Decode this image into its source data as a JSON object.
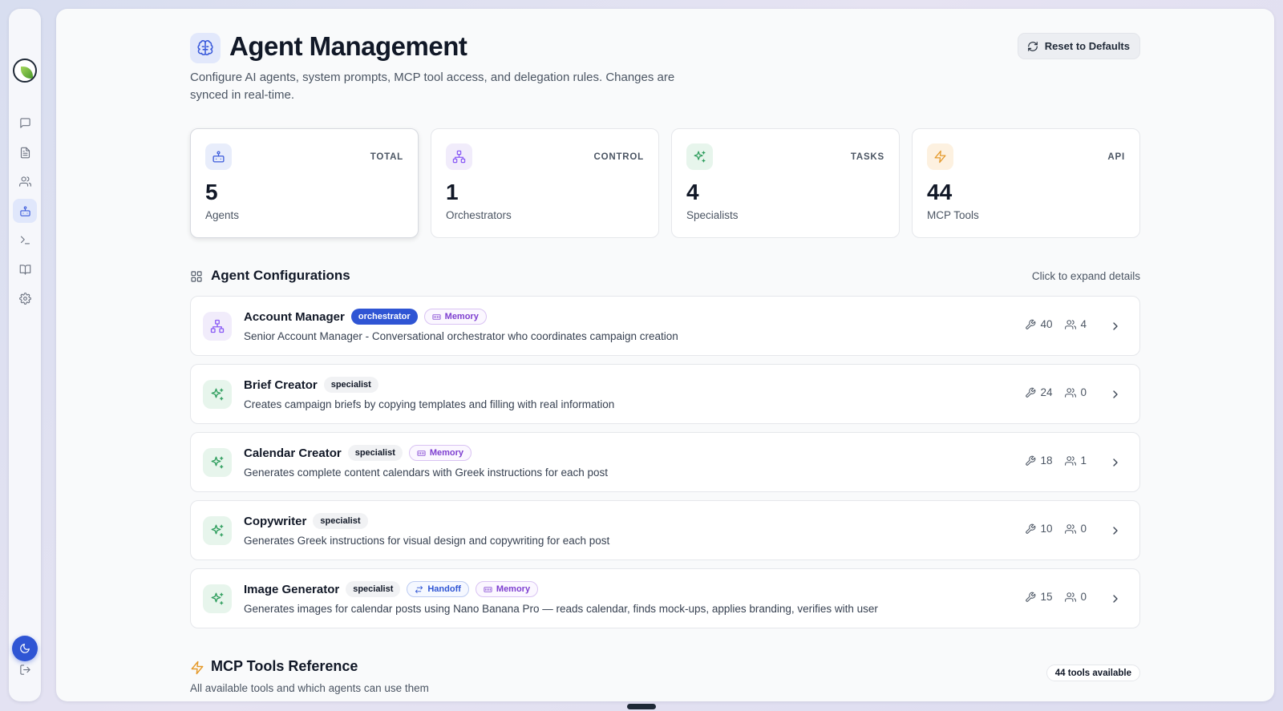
{
  "sidebar": {
    "items": [
      {
        "name": "chat",
        "icon": "message-square-icon"
      },
      {
        "name": "documents",
        "icon": "file-text-icon"
      },
      {
        "name": "users",
        "icon": "users-icon"
      },
      {
        "name": "agents",
        "icon": "bot-icon",
        "active": true
      },
      {
        "name": "terminal",
        "icon": "terminal-icon"
      },
      {
        "name": "docs",
        "icon": "book-open-icon"
      },
      {
        "name": "settings",
        "icon": "gear-icon"
      }
    ],
    "theme_icon": "moon-icon",
    "logout_icon": "log-out-icon"
  },
  "header": {
    "title": "Agent Management",
    "description": "Configure AI agents, system prompts, MCP tool access, and delegation rules. Changes are synced in real-time.",
    "reset_label": "Reset to Defaults"
  },
  "stats": [
    {
      "tag": "TOTAL",
      "value": "5",
      "label": "Agents",
      "icon": "bot-icon",
      "accent": "#3b5bdb",
      "bg": "#e8edfb"
    },
    {
      "tag": "CONTROL",
      "value": "1",
      "label": "Orchestrators",
      "icon": "network-icon",
      "accent": "#8b5cf6",
      "bg": "#f1ecfb"
    },
    {
      "tag": "TASKS",
      "value": "4",
      "label": "Specialists",
      "icon": "sparkles-icon",
      "accent": "#2f9e5e",
      "bg": "#e7f5ec"
    },
    {
      "tag": "API",
      "value": "44",
      "label": "MCP Tools",
      "icon": "zap-icon",
      "accent": "#e59a2b",
      "bg": "#fdf1e0"
    }
  ],
  "agents_section": {
    "title": "Agent Configurations",
    "hint": "Click to expand details"
  },
  "agents": [
    {
      "name": "Account Manager",
      "role": "orchestrator",
      "badges": [
        "Memory"
      ],
      "description": "Senior Account Manager - Conversational orchestrator who coordinates campaign creation",
      "tools": "40",
      "delegates": "4"
    },
    {
      "name": "Brief Creator",
      "role": "specialist",
      "badges": [],
      "description": "Creates campaign briefs by copying templates and filling with real information",
      "tools": "24",
      "delegates": "0"
    },
    {
      "name": "Calendar Creator",
      "role": "specialist",
      "badges": [
        "Memory"
      ],
      "description": "Generates complete content calendars with Greek instructions for each post",
      "tools": "18",
      "delegates": "1"
    },
    {
      "name": "Copywriter",
      "role": "specialist",
      "badges": [],
      "description": "Generates Greek instructions for visual design and copywriting for each post",
      "tools": "10",
      "delegates": "0"
    },
    {
      "name": "Image Generator",
      "role": "specialist",
      "badges": [
        "Handoff",
        "Memory"
      ],
      "description": "Generates images for calendar posts using Nano Banana Pro — reads calendar, finds mock-ups, applies branding, verifies with user",
      "tools": "15",
      "delegates": "0"
    }
  ],
  "mcp_section": {
    "title": "MCP Tools Reference",
    "description": "All available tools and which agents can use them",
    "count_label": "44 tools available"
  }
}
